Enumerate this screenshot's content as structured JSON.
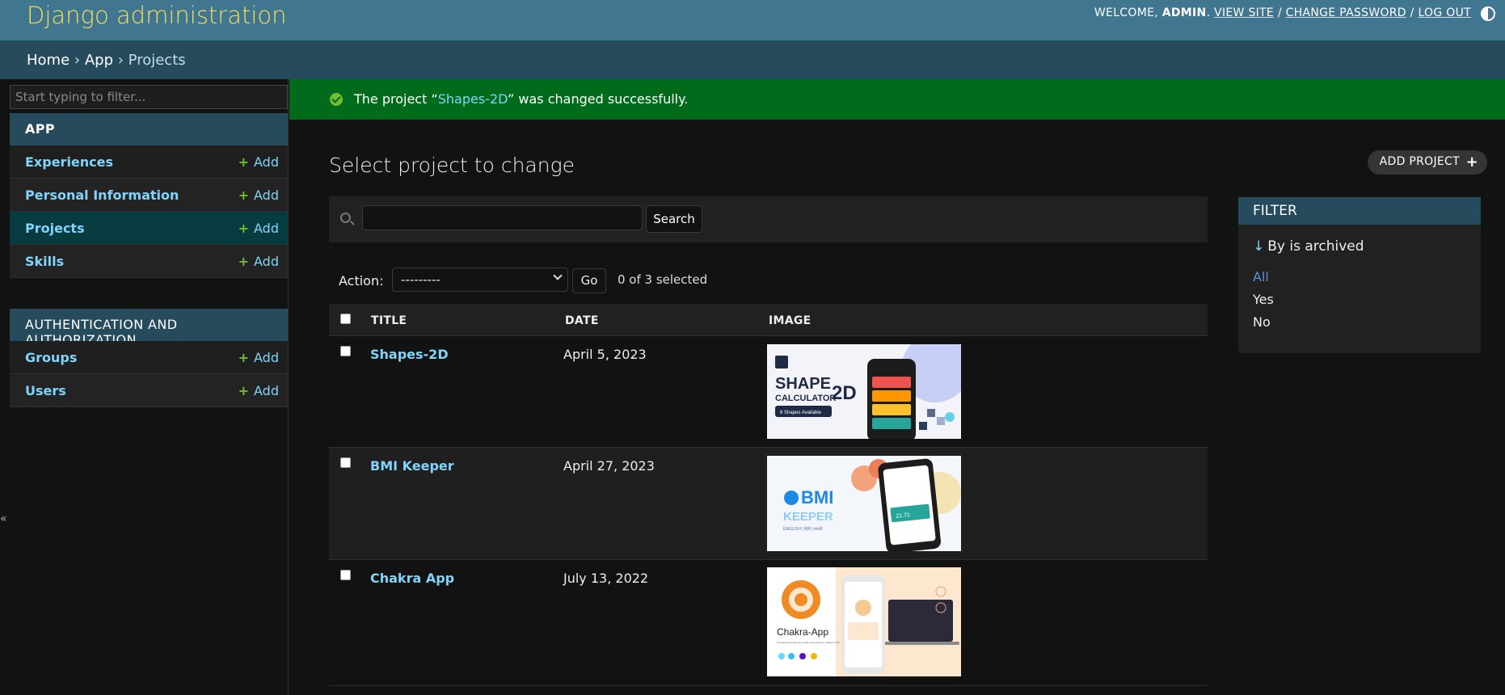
{
  "header": {
    "branding": "Django administration",
    "welcome": "WELCOME,",
    "username": "ADMIN",
    "view_site": "VIEW SITE",
    "change_password": "CHANGE PASSWORD",
    "log_out": "LOG OUT",
    "sep": "/",
    "dot": ".",
    "theme_icon": "contrast-toggle-icon"
  },
  "breadcrumbs": [
    "Home",
    "App",
    "Projects"
  ],
  "breadcrumb_sep": "›",
  "sidebar": {
    "filter_placeholder": "Start typing to filter...",
    "modules": [
      {
        "caption": "APP",
        "items": [
          {
            "label": "Experiences",
            "add": "Add"
          },
          {
            "label": "Personal Information",
            "add": "Add"
          },
          {
            "label": "Projects",
            "add": "Add",
            "current": true
          },
          {
            "label": "Skills",
            "add": "Add"
          }
        ]
      },
      {
        "caption": "AUTHENTICATION AND AUTHORIZATION",
        "items": [
          {
            "label": "Groups",
            "add": "Add"
          },
          {
            "label": "Users",
            "add": "Add"
          }
        ]
      }
    ],
    "collapse_glyph": "«"
  },
  "message": {
    "prefix": "The project “",
    "object": "Shapes-2D",
    "suffix": "” was changed successfully."
  },
  "main": {
    "title": "Select project to change",
    "add_button": "ADD PROJECT",
    "search_button": "Search",
    "action_label": "Action:",
    "action_value": "---------",
    "go_button": "Go",
    "selected_count": "0 of 3 selected"
  },
  "table": {
    "columns": [
      "TITLE",
      "DATE",
      "IMAGE"
    ],
    "rows": [
      {
        "title": "Shapes-2D",
        "date": "April 5, 2023"
      },
      {
        "title": "BMI Keeper",
        "date": "April 27, 2023"
      },
      {
        "title": "Chakra App",
        "date": "July 13, 2022"
      }
    ]
  },
  "thumbs": {
    "shapes": {
      "brand": "SHAPE",
      "sub": "CALCULATOR",
      "num": "2D",
      "badge": "8 Shapes Available"
    },
    "bmi": {
      "brand": "BMI",
      "sub": "KEEPER",
      "langs": "ENGLISH  |  हिंदी  |  मराठी",
      "reading": "21.71"
    },
    "chakra": {
      "brand": "Chakra-App",
      "tagline": "A Progressive Web App made using React & Tailwind CSS"
    }
  },
  "filter": {
    "heading": "FILTER",
    "subheading": "By is archived",
    "choices": [
      "All",
      "Yes",
      "No"
    ],
    "selected": "All"
  },
  "colors": {
    "header": "#417690",
    "breadcrumbs": "#264b5d",
    "branding": "#f5dd5d",
    "link": "#81d4fa",
    "success": "#006b1b",
    "add_plus": "#70bf2b",
    "current_row": "#063c40"
  }
}
